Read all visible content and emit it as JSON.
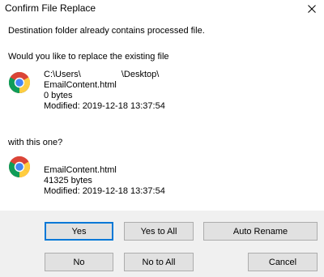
{
  "window": {
    "title": "Confirm File Replace"
  },
  "message": {
    "line1": "Destination folder already contains processed file.",
    "line2": "Would you like to replace the existing file",
    "line3": "with this one?"
  },
  "existing_file": {
    "path_prefix": "C:\\Users\\",
    "path_suffix": "\\Desktop\\",
    "name": "EmailContent.html",
    "size": "0 bytes",
    "modified": "Modified: 2019-12-18 13:37:54",
    "icon": "chrome-icon"
  },
  "new_file": {
    "name": "EmailContent.html",
    "size": "41325 bytes",
    "modified": "Modified: 2019-12-18 13:37:54",
    "icon": "chrome-icon"
  },
  "buttons": {
    "yes": "Yes",
    "yes_to_all": "Yes to All",
    "auto_rename": "Auto Rename",
    "no": "No",
    "no_to_all": "No to All",
    "cancel": "Cancel"
  },
  "colors": {
    "accent": "#0078d7",
    "button_face": "#e1e1e1",
    "button_area": "#f0f0f0"
  }
}
